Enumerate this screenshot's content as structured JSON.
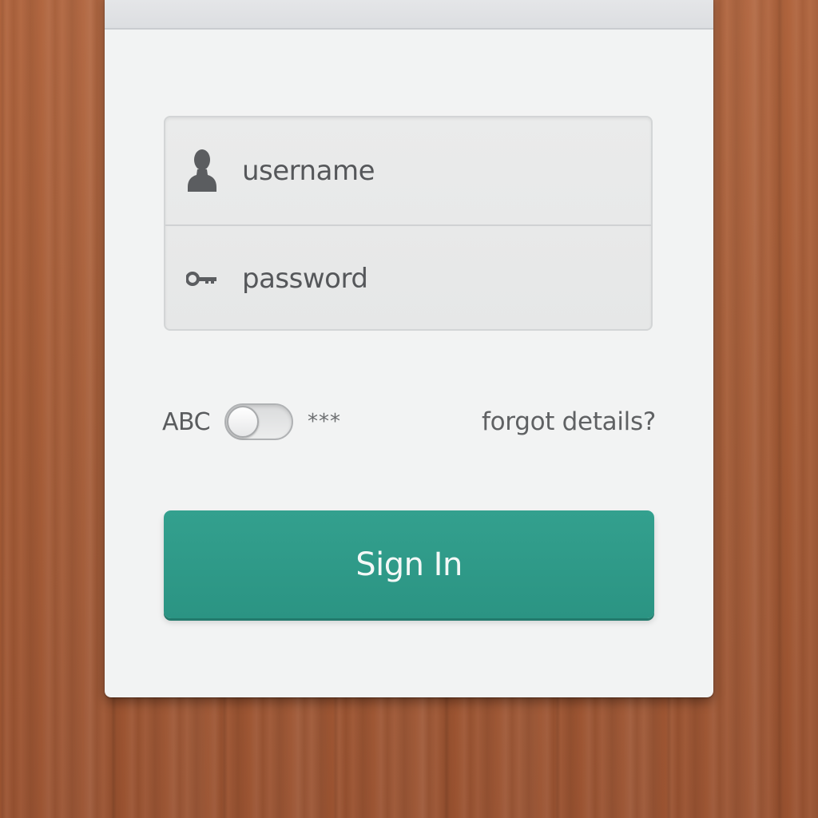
{
  "login_form": {
    "username": {
      "placeholder": "username",
      "value": "",
      "icon": "user-icon"
    },
    "password": {
      "placeholder": "password",
      "value": "",
      "icon": "key-icon"
    },
    "visibility_toggle": {
      "label_left": "ABC",
      "label_right": "***",
      "state": "off"
    },
    "forgot_link": "forgot details?",
    "submit_label": "Sign In"
  },
  "colors": {
    "background_wood": "#a45a35",
    "card": "#f2f3f3",
    "field_bg": "#e8e9e9",
    "accent_button": "#2e998a",
    "text": "#55575a"
  }
}
